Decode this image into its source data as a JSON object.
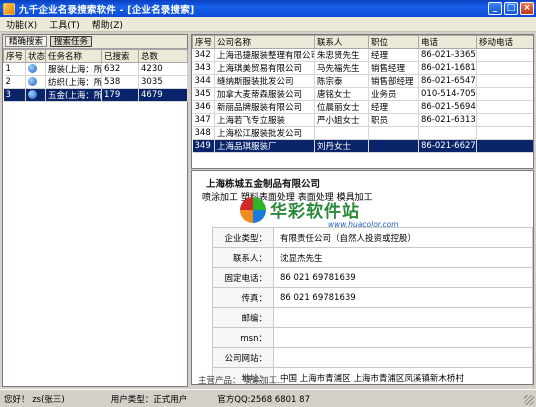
{
  "window": {
    "title": "九千企业名录搜索软件 - [企业名录搜索]",
    "buttons": [
      "_",
      "□",
      "×"
    ]
  },
  "menu": [
    "功能(X)",
    "工具(T)",
    "帮助(Z)"
  ],
  "left_toolbar": [
    "精确搜索",
    "搜索任务"
  ],
  "task_table": {
    "headers": [
      "序号",
      "状态",
      "任务名称",
      "已搜索",
      "总数"
    ],
    "rows": [
      {
        "no": "1",
        "name": "服装(上海：所",
        "searched": "632",
        "total": "4230"
      },
      {
        "no": "2",
        "name": "纺织(上海：所",
        "searched": "538",
        "total": "3035"
      },
      {
        "no": "3",
        "name": "五金(上海：所",
        "searched": "179",
        "total": "4679"
      }
    ]
  },
  "company_table": {
    "headers": [
      "序号",
      "公司名称",
      "联系人",
      "职位",
      "电话",
      "移动电话"
    ],
    "rows": [
      {
        "no": "342",
        "name": "上海迅捷服装整理有限公司",
        "contact": "朱忠贤先生",
        "position": "经理",
        "phone": "86-021-3365888"
      },
      {
        "no": "343",
        "name": "上海琪美贸易有限公司",
        "contact": "马先福先生",
        "position": "销售经理",
        "phone": "86-021-1681688"
      },
      {
        "no": "344",
        "name": "缝纳斯服装批发公司",
        "contact": "陈宗泰",
        "position": "销售部经理",
        "phone": "86-021-6547456"
      },
      {
        "no": "345",
        "name": "加拿大麦蒂森服装公司",
        "contact": "唐铭女士",
        "position": "业务员",
        "phone": "010-514-70580"
      },
      {
        "no": "346",
        "name": "新丽品牌服装有限公司",
        "contact": "位晨丽女士",
        "position": "经理",
        "phone": "86-021-5694168"
      },
      {
        "no": "347",
        "name": "上海若飞专立服装",
        "contact": "严小姐女士",
        "position": "职员",
        "phone": "86-021-6313236"
      },
      {
        "no": "348",
        "name": "上海松江服装批发公司",
        "contact": "",
        "position": "",
        "phone": ""
      },
      {
        "no": "349",
        "name": "上海品琪服装厂",
        "contact": "刘丹女士",
        "position": "",
        "phone": "86-021-662777"
      }
    ]
  },
  "detail": {
    "company": "上海栋城五金制品有限公司",
    "business": "喷涂加工  塑料表面处理  表面处理  模具加工",
    "watermark": {
      "text": "华彩软件站",
      "url": "www.huacolor.com"
    },
    "fields": [
      {
        "label": "企业类型：",
        "value": "有限责任公司（自然人投资或控股）"
      },
      {
        "label": "联系人：",
        "value": "沈显杰先生"
      },
      {
        "label": "固定电话：",
        "value": "86  021  69781639"
      },
      {
        "label": "传真：",
        "value": "86  021  69781639"
      },
      {
        "label": "邮编：",
        "value": ""
      },
      {
        "label": "msn：",
        "value": ""
      },
      {
        "label": "公司网站：",
        "value": ""
      },
      {
        "label": "地址：",
        "value": "中国  上海市青浦区  上海市青浦区凤溪镇新木桥村"
      }
    ],
    "cut_row": "主营产品：  喷涂加工..."
  },
  "statusbar": {
    "greeting": "您好！ zs(张三)",
    "user_type": "用户类型：正式用户",
    "qq": "官方QQ:2568 6801 87"
  },
  "colors": {
    "titlebar": "#0c4ad4",
    "selection": "#0a246a",
    "chrome": "#d4d0c8"
  }
}
